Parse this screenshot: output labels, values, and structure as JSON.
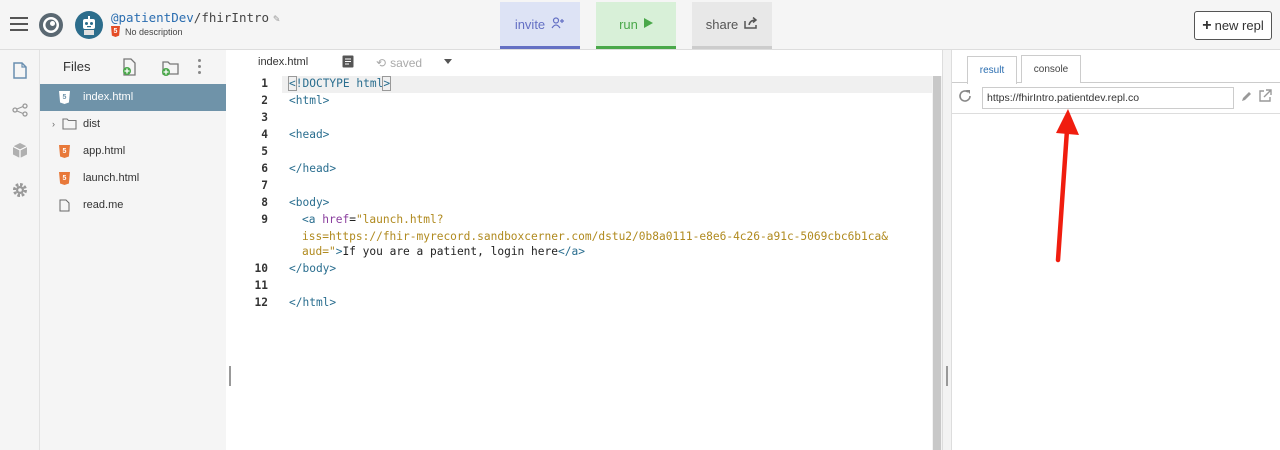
{
  "header": {
    "owner": "@patientDev",
    "separator": "/",
    "repl_name": "fhirIntro",
    "description": "No description",
    "invite_label": "invite",
    "run_label": "run",
    "share_label": "share",
    "new_repl_label": "new repl"
  },
  "files_panel": {
    "title": "Files",
    "items": [
      {
        "name": "index.html",
        "type": "html",
        "selected": true
      },
      {
        "name": "dist",
        "type": "folder",
        "selected": false
      },
      {
        "name": "app.html",
        "type": "html",
        "selected": false
      },
      {
        "name": "launch.html",
        "type": "html",
        "selected": false
      },
      {
        "name": "read.me",
        "type": "file",
        "selected": false
      }
    ]
  },
  "editor": {
    "active_file": "index.html",
    "save_status": "saved",
    "line_numbers": [
      "1",
      "2",
      "3",
      "4",
      "5",
      "6",
      "7",
      "8",
      "9",
      "10",
      "11",
      "12"
    ],
    "code": {
      "doctype_open": "<",
      "doctype_kw": "!DOCTYPE",
      "doctype_html": "html",
      "doctype_close": ">",
      "html_open": "<html>",
      "head_open": "<head>",
      "head_close": "</head>",
      "body_open": "<body>",
      "a_open": "<a",
      "href_attr": "href",
      "href_eq": "=",
      "href_line1": "\"launch.html?",
      "href_line2": "iss=https://fhir-myrecord.sandboxcerner.com/dstu2/0b8a0111-e8e6-4c26-a91c-5069cbc6b1ca&",
      "href_line3": "aud=\"",
      "a_gt": ">",
      "link_text": "If you are a patient, login here",
      "a_close_lt": "</",
      "a_close_name": "a",
      "a_close_gt": ">",
      "body_close": "</body>",
      "html_close": "</html>"
    }
  },
  "output_panel": {
    "tabs": [
      "result",
      "console"
    ],
    "active_tab": "result",
    "url": "https://fhirIntro.patientdev.repl.co"
  },
  "colors": {
    "invite": "#6470c4",
    "run": "#4aa84a",
    "selected_file": "#6f93a9",
    "annotation_arrow": "#f01d0f"
  }
}
